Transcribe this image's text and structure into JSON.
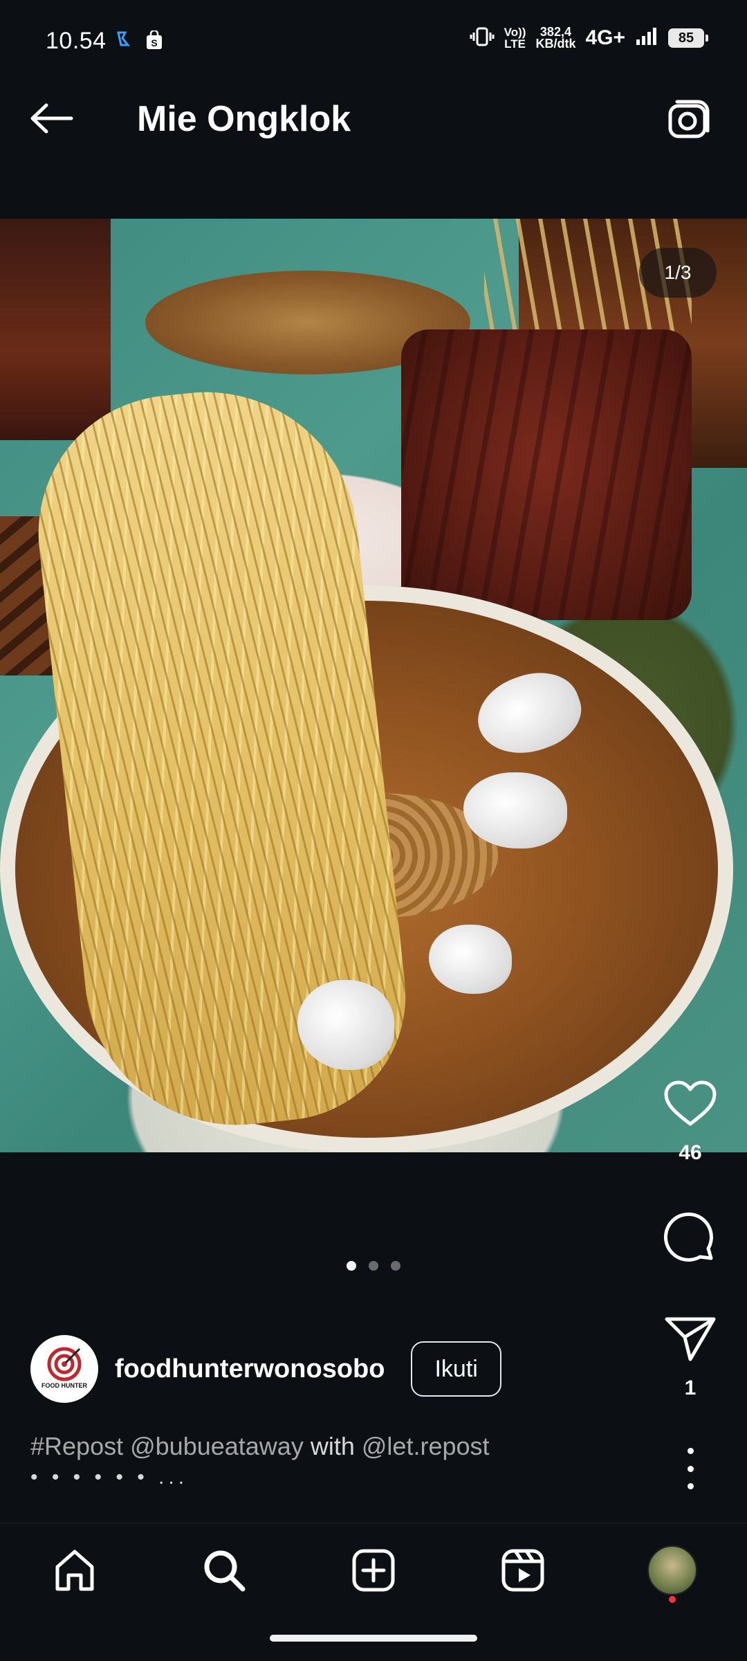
{
  "status_bar": {
    "time": "10.54",
    "network_line1": "382,4",
    "network_line2": "KB/dtk",
    "volte_line1": "Vo))",
    "volte_line2": "LTE",
    "network_type": "4G+",
    "battery": "85"
  },
  "header": {
    "title": "Mie Ongklok"
  },
  "post": {
    "image_counter": "1/3",
    "likes": "46",
    "shares": "1",
    "carousel": {
      "count": 3,
      "active": 0
    }
  },
  "author": {
    "username": "foodhunterwonosobo",
    "avatar_brand": "FOOD HUNTER",
    "follow_label": "Ikuti"
  },
  "caption": {
    "hashtag": "#Repost",
    "mention1": "@bubueataway",
    "text": "with",
    "mention2": "@let.repost",
    "more": "• • • • • • ..."
  },
  "icons": {
    "back": "arrow-left-icon",
    "camera": "camera-icon",
    "like": "heart-icon",
    "comment": "comment-icon",
    "share": "send-icon",
    "more": "more-vertical-icon",
    "nav": [
      "home-icon",
      "search-icon",
      "add-post-icon",
      "reels-icon",
      "profile-avatar"
    ]
  },
  "colors": {
    "background": "#0c1014",
    "text": "#f5f5f5",
    "caption": "#bfbfbf",
    "notification": "#ff3040"
  }
}
